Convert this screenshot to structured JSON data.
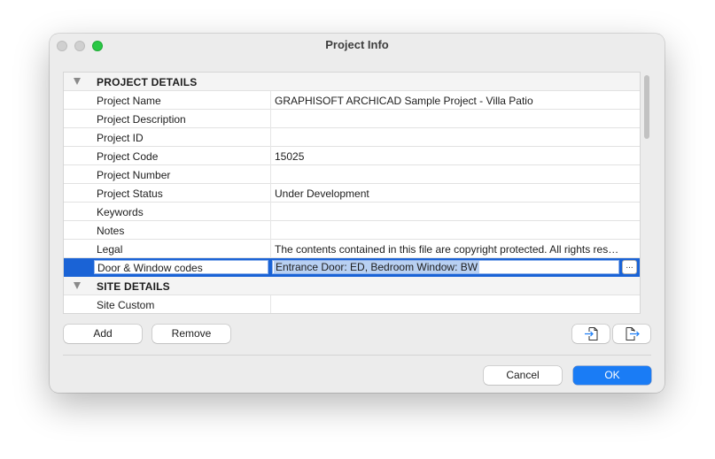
{
  "window": {
    "title": "Project Info"
  },
  "table": {
    "rows": [
      {
        "type": "header",
        "name": "PROJECT DETAILS",
        "value": ""
      },
      {
        "type": "field",
        "name": "Project Name",
        "value": "GRAPHISOFT ARCHICAD Sample Project - Villa Patio"
      },
      {
        "type": "field",
        "name": "Project Description",
        "value": ""
      },
      {
        "type": "field",
        "name": "Project ID",
        "value": ""
      },
      {
        "type": "field",
        "name": "Project Code",
        "value": "15025"
      },
      {
        "type": "field",
        "name": "Project Number",
        "value": ""
      },
      {
        "type": "field",
        "name": "Project Status",
        "value": "Under Development"
      },
      {
        "type": "field",
        "name": "Keywords",
        "value": ""
      },
      {
        "type": "field",
        "name": "Notes",
        "value": ""
      },
      {
        "type": "field",
        "name": "Legal",
        "value": "The contents contained in this file are copyright protected. All rights reser..."
      },
      {
        "type": "selected",
        "name": "Door & Window codes",
        "value": "Entrance Door: ED, Bedroom Window: BW",
        "button": "..."
      },
      {
        "type": "header",
        "name": "SITE DETAILS",
        "value": ""
      },
      {
        "type": "field",
        "name": "Site Custom",
        "value": ""
      }
    ]
  },
  "buttons": {
    "add": "Add",
    "remove": "Remove",
    "import_icon": "import-icon",
    "export_icon": "export-icon",
    "cancel": "Cancel",
    "ok": "OK"
  },
  "colors": {
    "selection": "#1a63d6",
    "ok_button": "#1a7cf5",
    "zoom_light": "#2ac845"
  }
}
